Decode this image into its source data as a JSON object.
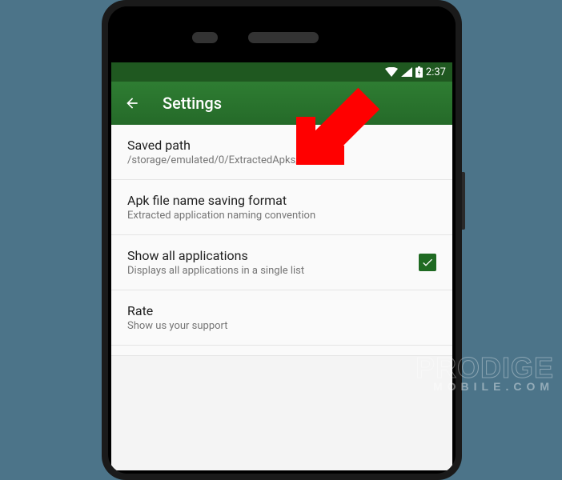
{
  "status": {
    "time": "2:37"
  },
  "header": {
    "title": "Settings"
  },
  "settings": [
    {
      "title": "Saved path",
      "subtitle": "/storage/emulated/0/ExtractedApks/"
    },
    {
      "title": "Apk file name saving format",
      "subtitle": "Extracted application naming convention"
    },
    {
      "title": "Show all applications",
      "subtitle": "Displays all applications in a single list",
      "checked": true
    },
    {
      "title": "Rate",
      "subtitle": "Show us your support"
    }
  ],
  "watermark": {
    "line1": "PRODIGE",
    "line2": "MOBILE.COM"
  }
}
